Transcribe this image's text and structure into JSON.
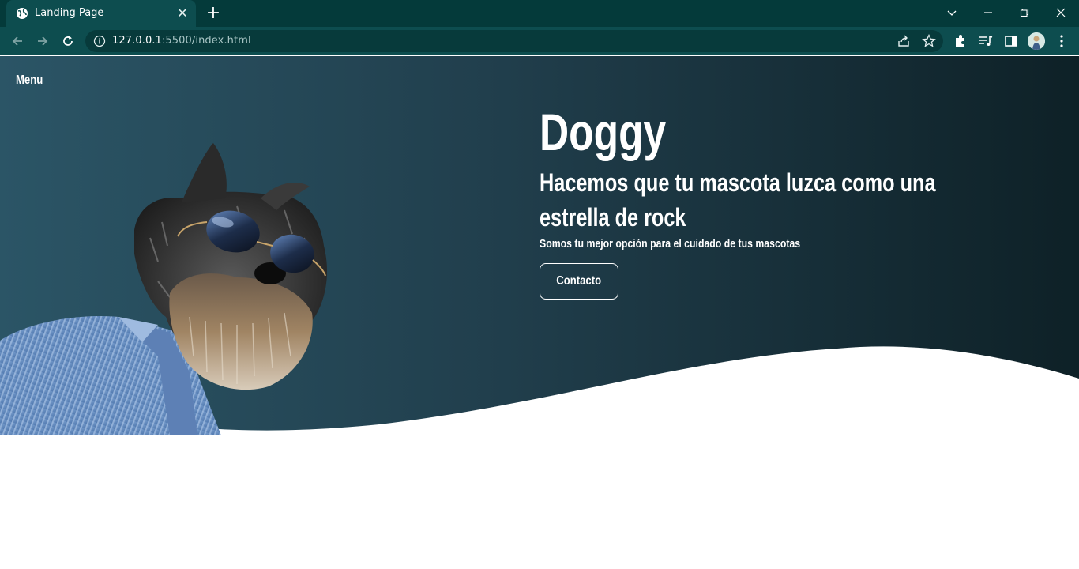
{
  "browser": {
    "tab_title": "Landing Page",
    "new_tab_icon": "plus-icon",
    "url_host": "127.0.0.1",
    "url_rest": ":5500/index.html",
    "theme_color": "#0d4d4f"
  },
  "page": {
    "menu_label": "Menu",
    "title": "Doggy",
    "subtitle": "Hacemos que tu mascota luzca como una estrella de rock",
    "description": "Somos tu mejor opción para el cuidado de tus mascotas",
    "contact_button": "Contacto",
    "gradient_left": "#2b5566",
    "gradient_right": "#0e2127"
  }
}
